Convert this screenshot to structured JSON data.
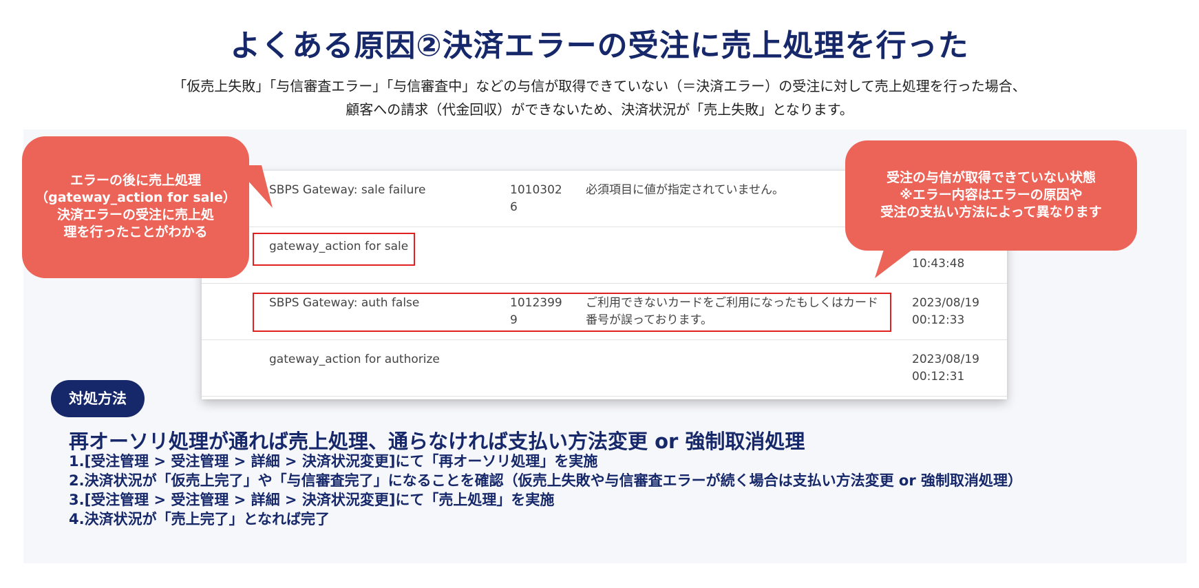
{
  "title": "よくある原因②決済エラーの受注に売上処理を行った",
  "subtitle": {
    "line1": "「仮売上失敗」「与信審査エラー」「与信審査中」などの与信が取得できていない（＝決済エラー）の受注に対して売上処理を行った場合、",
    "line2": "顧客への請求（代金回収）ができないため、決済状況が「売上失敗」となります。"
  },
  "log_rows": [
    {
      "event": "SBPS Gateway: sale failure",
      "code": "1010302\n6",
      "message": "必須項目に値が指定されていません。",
      "date": ""
    },
    {
      "event": "gateway_action for sale",
      "code": "",
      "message": "",
      "date": "10:43:48"
    },
    {
      "event": "SBPS Gateway: auth false",
      "code": "1012399\n9",
      "message": "ご利用できないカードをご利用になったもしくはカード番号が誤っております。",
      "date": "2023/08/19\n00:12:33"
    },
    {
      "event": "gateway_action for authorize",
      "code": "",
      "message": "",
      "date": "2023/08/19\n00:12:31"
    }
  ],
  "callouts": {
    "left": "エラーの後に売上処理\n（gateway_action for sale）\n決済エラーの受注に売上処\n理を行ったことがわかる",
    "right": "受注の与信が取得できていない状態\n※エラー内容はエラーの原因や\n受注の支払い方法によって異なります"
  },
  "solution": {
    "badge": "対処方法",
    "heading": "再オーソリ処理が通れば売上処理、通らなければ支払い方法変更 or 強制取消処理",
    "steps": [
      "1.[受注管理 > 受注管理 > 詳細 > 決済状況変更]にて「再オーソリ処理」を実施",
      "2.決済状況が「仮売上完了」や「与信審査完了」になることを確認（仮売上失敗や与信審査エラーが続く場合は支払い方法変更 or 強制取消処理）",
      "3.[受注管理 > 受注管理 > 詳細 > 決済状況変更]にて「売上処理」を実施",
      "4.決済状況が「売上完了」となれば完了"
    ]
  },
  "colors": {
    "navy": "#16286a",
    "callout": "#ec6358",
    "highlight": "#e02020",
    "panel": "#f6f7fa"
  }
}
